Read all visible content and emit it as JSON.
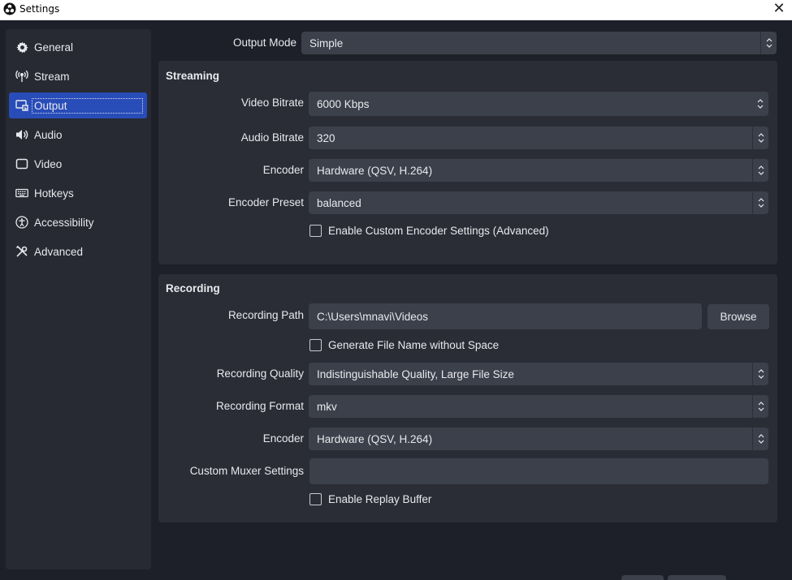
{
  "window": {
    "title": "Settings",
    "close_glyph": "✕"
  },
  "sidebar": {
    "items": [
      {
        "label": "General",
        "icon": "gear-icon"
      },
      {
        "label": "Stream",
        "icon": "antenna-icon"
      },
      {
        "label": "Output",
        "icon": "output-icon",
        "active": true
      },
      {
        "label": "Audio",
        "icon": "speaker-icon"
      },
      {
        "label": "Video",
        "icon": "monitor-icon"
      },
      {
        "label": "Hotkeys",
        "icon": "keyboard-icon"
      },
      {
        "label": "Accessibility",
        "icon": "accessibility-icon"
      },
      {
        "label": "Advanced",
        "icon": "tools-icon"
      }
    ]
  },
  "output_mode": {
    "label": "Output Mode",
    "value": "Simple"
  },
  "streaming": {
    "title": "Streaming",
    "video_bitrate": {
      "label": "Video Bitrate",
      "value": "6000 Kbps"
    },
    "audio_bitrate": {
      "label": "Audio Bitrate",
      "value": "320"
    },
    "encoder": {
      "label": "Encoder",
      "value": "Hardware (QSV, H.264)"
    },
    "encoder_preset": {
      "label": "Encoder Preset",
      "value": "balanced"
    },
    "custom_encoder": {
      "label": "Enable Custom Encoder Settings (Advanced)",
      "checked": false
    }
  },
  "recording": {
    "title": "Recording",
    "path": {
      "label": "Recording Path",
      "value": "C:\\Users\\mnavi\\Videos",
      "browse": "Browse"
    },
    "no_space": {
      "label": "Generate File Name without Space",
      "checked": false
    },
    "quality": {
      "label": "Recording Quality",
      "value": "Indistinguishable Quality, Large File Size"
    },
    "format": {
      "label": "Recording Format",
      "value": "mkv"
    },
    "encoder": {
      "label": "Encoder",
      "value": "Hardware (QSV, H.264)"
    },
    "muxer": {
      "label": "Custom Muxer Settings",
      "value": ""
    },
    "replay_buffer": {
      "label": "Enable Replay Buffer",
      "checked": false
    }
  },
  "colors": {
    "accent": "#284cb8",
    "background": "#1e2029",
    "panel": "#2a2d36",
    "field": "#3c404b"
  }
}
